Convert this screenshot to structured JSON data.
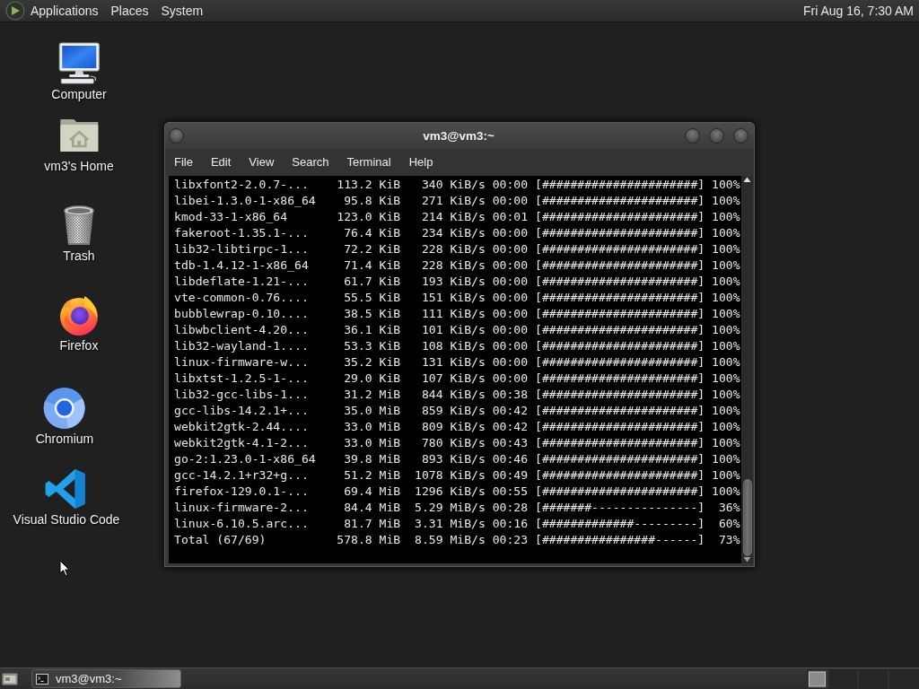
{
  "top_panel": {
    "menus": [
      "Applications",
      "Places",
      "System"
    ],
    "clock": "Fri Aug 16, 7:30 AM"
  },
  "desktop_icons": [
    {
      "label": "Computer",
      "kind": "computer"
    },
    {
      "label": "vm3's Home",
      "kind": "home"
    },
    {
      "label": "Trash",
      "kind": "trash"
    },
    {
      "label": "Firefox",
      "kind": "firefox"
    },
    {
      "label": "Chromium",
      "kind": "chromium"
    },
    {
      "label": "Visual Studio Code",
      "kind": "vscode"
    }
  ],
  "terminal_window": {
    "title": "vm3@vm3:~",
    "menu": [
      "File",
      "Edit",
      "View",
      "Search",
      "Terminal",
      "Help"
    ],
    "lines": [
      {
        "name": "libxfont2-2.0.7-...",
        "size": "113.2 KiB",
        "rate": "340 KiB/s",
        "eta": "00:00",
        "bar": "[######################]",
        "percent": "100%"
      },
      {
        "name": "libei-1.3.0-1-x86_64",
        "size": "95.8 KiB",
        "rate": "271 KiB/s",
        "eta": "00:00",
        "bar": "[######################]",
        "percent": "100%"
      },
      {
        "name": "kmod-33-1-x86_64",
        "size": "123.0 KiB",
        "rate": "214 KiB/s",
        "eta": "00:01",
        "bar": "[######################]",
        "percent": "100%"
      },
      {
        "name": "fakeroot-1.35.1-...",
        "size": "76.4 KiB",
        "rate": "234 KiB/s",
        "eta": "00:00",
        "bar": "[######################]",
        "percent": "100%"
      },
      {
        "name": "lib32-libtirpc-1...",
        "size": "72.2 KiB",
        "rate": "228 KiB/s",
        "eta": "00:00",
        "bar": "[######################]",
        "percent": "100%"
      },
      {
        "name": "tdb-1.4.12-1-x86_64",
        "size": "71.4 KiB",
        "rate": "228 KiB/s",
        "eta": "00:00",
        "bar": "[######################]",
        "percent": "100%"
      },
      {
        "name": "libdeflate-1.21-...",
        "size": "61.7 KiB",
        "rate": "193 KiB/s",
        "eta": "00:00",
        "bar": "[######################]",
        "percent": "100%"
      },
      {
        "name": "vte-common-0.76....",
        "size": "55.5 KiB",
        "rate": "151 KiB/s",
        "eta": "00:00",
        "bar": "[######################]",
        "percent": "100%"
      },
      {
        "name": "bubblewrap-0.10....",
        "size": "38.5 KiB",
        "rate": "111 KiB/s",
        "eta": "00:00",
        "bar": "[######################]",
        "percent": "100%"
      },
      {
        "name": "libwbclient-4.20...",
        "size": "36.1 KiB",
        "rate": "101 KiB/s",
        "eta": "00:00",
        "bar": "[######################]",
        "percent": "100%"
      },
      {
        "name": "lib32-wayland-1....",
        "size": "53.3 KiB",
        "rate": "108 KiB/s",
        "eta": "00:00",
        "bar": "[######################]",
        "percent": "100%"
      },
      {
        "name": "linux-firmware-w...",
        "size": "35.2 KiB",
        "rate": "131 KiB/s",
        "eta": "00:00",
        "bar": "[######################]",
        "percent": "100%"
      },
      {
        "name": "libxtst-1.2.5-1-...",
        "size": "29.0 KiB",
        "rate": "107 KiB/s",
        "eta": "00:00",
        "bar": "[######################]",
        "percent": "100%"
      },
      {
        "name": "lib32-gcc-libs-1...",
        "size": "31.2 MiB",
        "rate": "844 KiB/s",
        "eta": "00:38",
        "bar": "[######################]",
        "percent": "100%"
      },
      {
        "name": "gcc-libs-14.2.1+...",
        "size": "35.0 MiB",
        "rate": "859 KiB/s",
        "eta": "00:42",
        "bar": "[######################]",
        "percent": "100%"
      },
      {
        "name": "webkit2gtk-2.44....",
        "size": "33.0 MiB",
        "rate": "809 KiB/s",
        "eta": "00:42",
        "bar": "[######################]",
        "percent": "100%"
      },
      {
        "name": "webkit2gtk-4.1-2...",
        "size": "33.0 MiB",
        "rate": "780 KiB/s",
        "eta": "00:43",
        "bar": "[######################]",
        "percent": "100%"
      },
      {
        "name": "go-2:1.23.0-1-x86_64",
        "size": "39.8 MiB",
        "rate": "893 KiB/s",
        "eta": "00:46",
        "bar": "[######################]",
        "percent": "100%"
      },
      {
        "name": "gcc-14.2.1+r32+g...",
        "size": "51.2 MiB",
        "rate": "1078 KiB/s",
        "eta": "00:49",
        "bar": "[######################]",
        "percent": "100%"
      },
      {
        "name": "firefox-129.0.1-...",
        "size": "69.4 MiB",
        "rate": "1296 KiB/s",
        "eta": "00:55",
        "bar": "[######################]",
        "percent": "100%"
      },
      {
        "name": "linux-firmware-2...",
        "size": "84.4 MiB",
        "rate": "5.29 MiB/s",
        "eta": "00:28",
        "bar": "[#######---------------]",
        "percent": "36%"
      },
      {
        "name": "linux-6.10.5.arc...",
        "size": "81.7 MiB",
        "rate": "3.31 MiB/s",
        "eta": "00:16",
        "bar": "[#############---------]",
        "percent": "60%"
      },
      {
        "name": "Total (67/69)",
        "size": "578.8 MiB",
        "rate": "8.59 MiB/s",
        "eta": "00:23",
        "bar": "[################------]",
        "percent": "73%"
      }
    ]
  },
  "bottom_panel": {
    "windows": [
      {
        "label": "vm3@vm3:~",
        "selected": true
      }
    ]
  }
}
